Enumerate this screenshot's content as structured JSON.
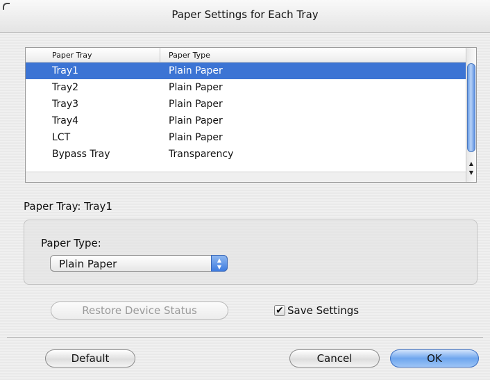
{
  "window": {
    "title": "Paper Settings for Each Tray"
  },
  "table": {
    "columns": [
      "Paper Tray",
      "Paper Type"
    ],
    "rows": [
      {
        "tray": "Tray1",
        "type": "Plain Paper",
        "selected": true
      },
      {
        "tray": "Tray2",
        "type": "Plain Paper"
      },
      {
        "tray": "Tray3",
        "type": "Plain Paper"
      },
      {
        "tray": "Tray4",
        "type": "Plain Paper"
      },
      {
        "tray": "LCT",
        "type": "Plain Paper"
      },
      {
        "tray": "Bypass Tray",
        "type": "Transparency"
      }
    ]
  },
  "tray_label": "Paper Tray: Tray1",
  "paper_type": {
    "label": "Paper Type:",
    "selected": "Plain Paper"
  },
  "buttons": {
    "restore": "Restore Device Status",
    "default": "Default",
    "cancel": "Cancel",
    "ok": "OK"
  },
  "save_settings": {
    "label": "Save Settings",
    "checked": true
  },
  "colors": {
    "selection": "#3c74d4",
    "accent": "#6ea6ee"
  },
  "icons": {
    "checkmark": "checkmark-icon",
    "stepper": "stepper-arrows-icon",
    "scroll_up": "scroll-up-arrow-icon",
    "scroll_down": "scroll-down-arrow-icon"
  }
}
